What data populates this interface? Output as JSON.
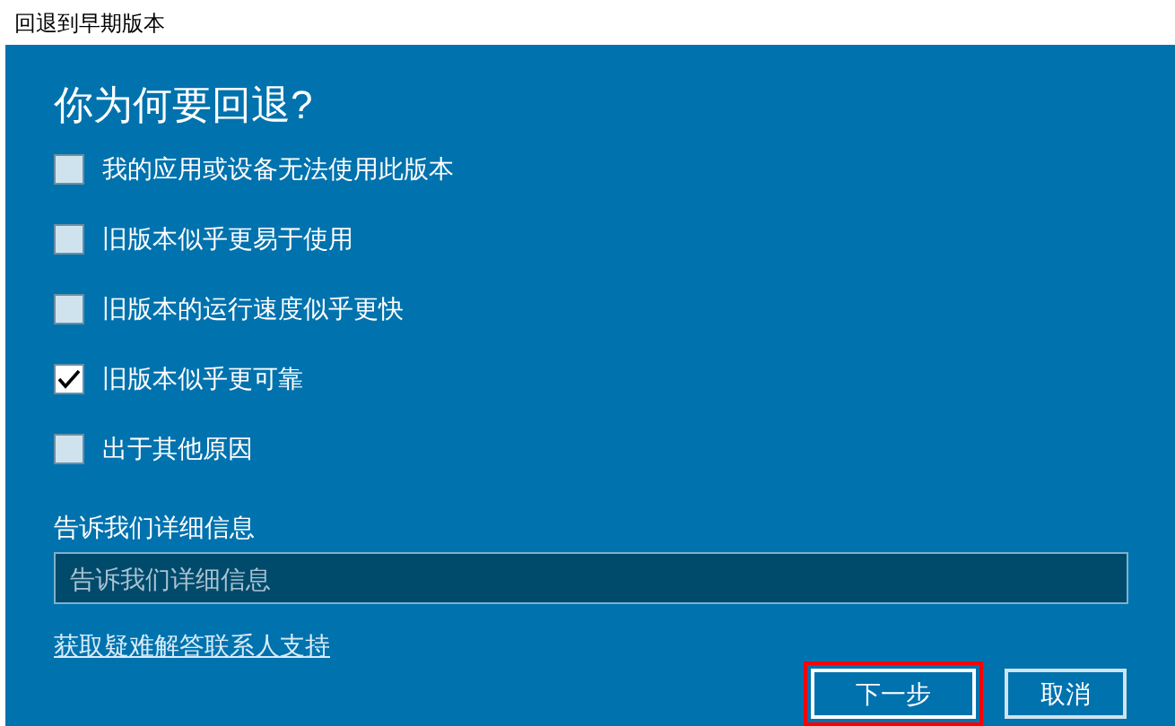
{
  "window": {
    "title": "回退到早期版本"
  },
  "heading": "你为何要回退?",
  "reasons": [
    {
      "label": "我的应用或设备无法使用此版本",
      "checked": false
    },
    {
      "label": "旧版本似乎更易于使用",
      "checked": false
    },
    {
      "label": "旧版本的运行速度似乎更快",
      "checked": false
    },
    {
      "label": "旧版本似乎更可靠",
      "checked": true
    },
    {
      "label": "出于其他原因",
      "checked": false
    }
  ],
  "details": {
    "label": "告诉我们详细信息",
    "placeholder": "告诉我们详细信息"
  },
  "support_link": "获取疑难解答联系人支持",
  "buttons": [
    {
      "label": "下一步",
      "selected": true
    },
    {
      "label": "取消",
      "selected": false
    }
  ]
}
